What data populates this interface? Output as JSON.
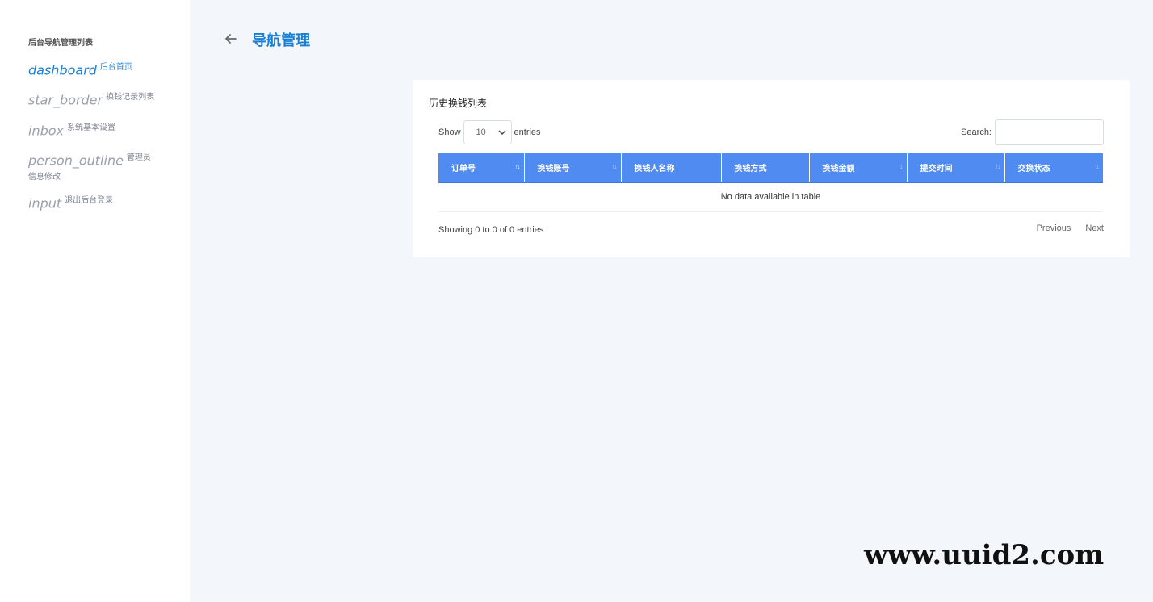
{
  "sidebar": {
    "heading": "后台导航管理列表",
    "items": [
      {
        "icon": "dashboard",
        "label": "后台首页"
      },
      {
        "icon": "star_border",
        "label": "换钱记录列表"
      },
      {
        "icon": "inbox",
        "label": "系统基本设置"
      },
      {
        "icon": "person_outline",
        "label": "管理员信息修改"
      },
      {
        "icon": "input",
        "label": "退出后台登录"
      }
    ]
  },
  "header": {
    "title": "导航管理"
  },
  "card": {
    "title": "历史换钱列表",
    "show_label": "Show",
    "length_value": "10",
    "entries_label": "entries",
    "search_label": "Search:",
    "columns": [
      "订单号",
      "换钱账号",
      "换钱人名称",
      "换钱方式",
      "换钱金额",
      "提交时间",
      "交换状态"
    ],
    "empty_message": "No data available in table",
    "info": "Showing 0 to 0 of 0 entries",
    "pager": {
      "previous": "Previous",
      "next": "Next"
    }
  },
  "watermark": "www.uuid2.com",
  "colors": {
    "accent": "#1a7fd4",
    "header_bg": "#4f8bf1",
    "page_bg": "#f3f6fb"
  }
}
